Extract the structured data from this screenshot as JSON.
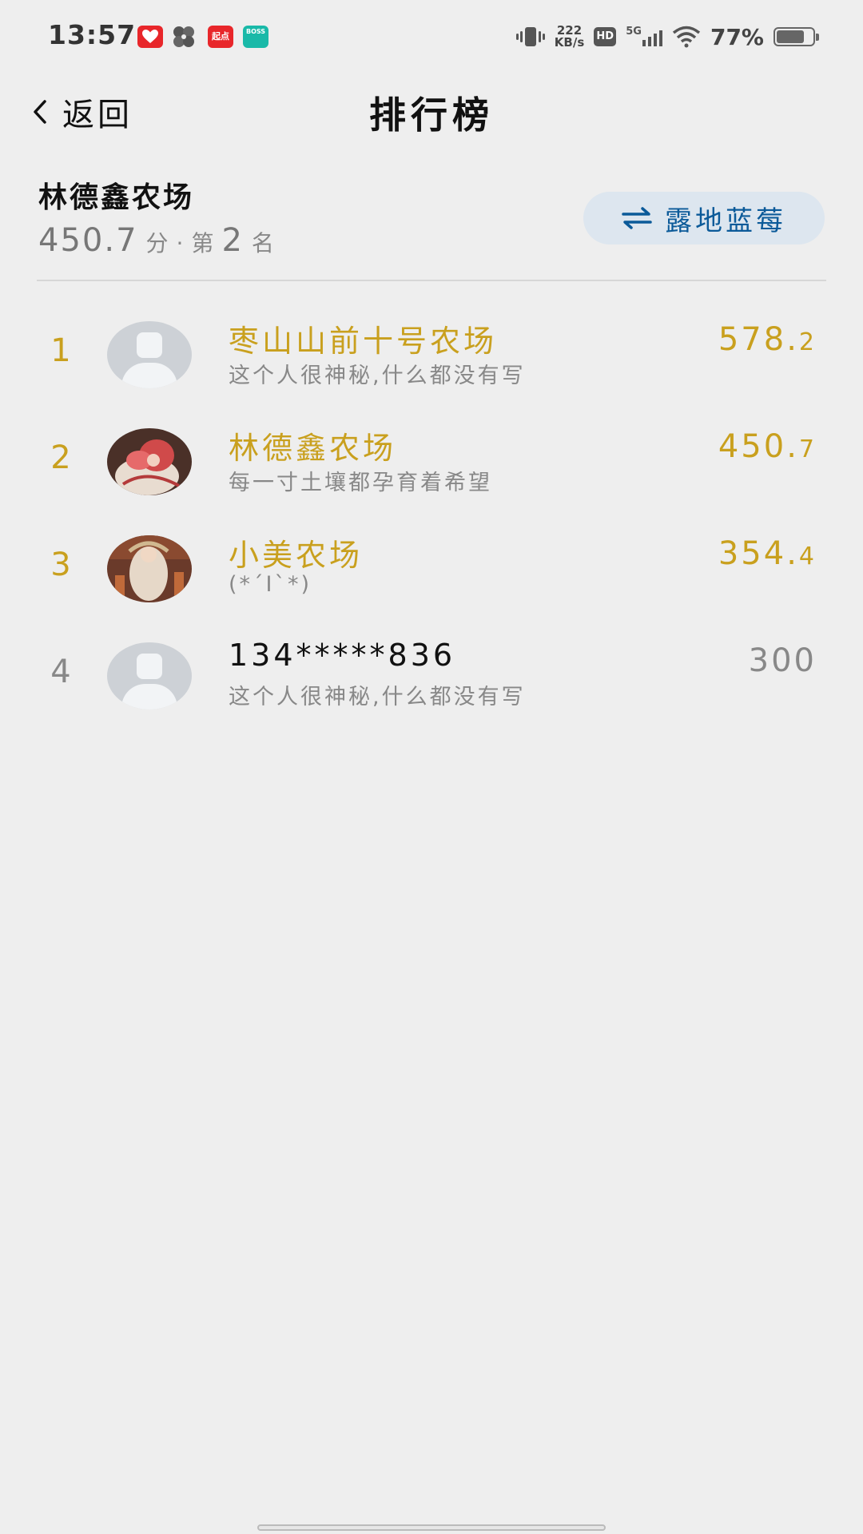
{
  "status_bar": {
    "time": "13:57",
    "apps": [
      {
        "name": "app-red-heart-icon",
        "color": "#e8262a",
        "text": ""
      },
      {
        "name": "app-pinwheel-icon",
        "color": "#555555",
        "text": ""
      },
      {
        "name": "app-qidian-icon",
        "color": "#e8262a",
        "text": "起点"
      },
      {
        "name": "app-boss-icon",
        "color": "#19b9a8",
        "text": "BOSS"
      }
    ],
    "net_speed_value": "222",
    "net_speed_unit": "KB/s",
    "hd_label": "HD",
    "signal_label": "5G",
    "battery_text": "77%",
    "battery_level": 0.77
  },
  "header": {
    "back_label": "返回",
    "title": "排行榜"
  },
  "summary": {
    "farm_name": "林德鑫农场",
    "score": "450.7",
    "score_unit": "分",
    "separator": "·",
    "rank_prefix": "第",
    "rank": "2",
    "rank_suffix": "名",
    "switch_label": "露地蓝莓"
  },
  "rankings": [
    {
      "rank": "1",
      "name": "枣山山前十号农场",
      "bio": "这个人很神秘,什么都没有写",
      "score_int": "578.",
      "score_dec": "2",
      "highlight": true,
      "avatar": "default"
    },
    {
      "rank": "2",
      "name": "林德鑫农场",
      "bio": "每一寸土壤都孕育着希望",
      "score_int": "450.",
      "score_dec": "7",
      "highlight": true,
      "avatar": "photo-red"
    },
    {
      "rank": "3",
      "name": "小美农场",
      "bio": "(*´I`*)",
      "score_int": "354.",
      "score_dec": "4",
      "highlight": true,
      "avatar": "photo-gold"
    },
    {
      "rank": "4",
      "name": "134*****836",
      "bio": "这个人很神秘,什么都没有写",
      "score_int": "300",
      "score_dec": "",
      "highlight": false,
      "avatar": "default"
    }
  ],
  "colors": {
    "gold": "#c9a01e",
    "switch_bg": "#dde6ef",
    "switch_text": "#0b5a99",
    "background": "#eeeeee"
  }
}
